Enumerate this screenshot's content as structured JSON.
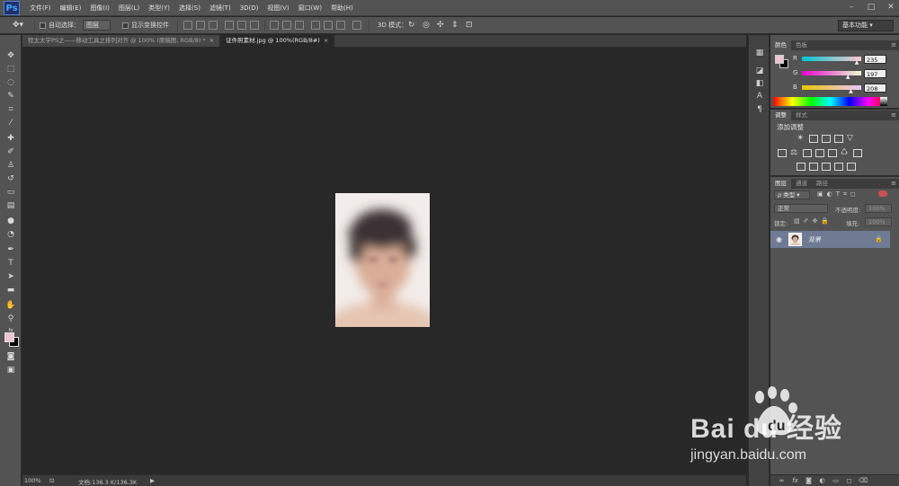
{
  "app": {
    "logo": "Ps",
    "menu": [
      "文件(F)",
      "编辑(E)",
      "图像(I)",
      "图层(L)",
      "类型(Y)",
      "选择(S)",
      "滤镜(T)",
      "3D(D)",
      "视图(V)",
      "窗口(W)",
      "帮助(H)"
    ],
    "window_controls": [
      "–",
      "□",
      "✕"
    ]
  },
  "options_bar": {
    "auto_select_label": "自动选择：",
    "auto_select_value": "图层",
    "show_transform_label": "显示变换控件",
    "mode_3d_label": "3D 模式：",
    "workspace": "基本功能"
  },
  "document_tabs": [
    {
      "label": "程太太学PS之——移动工具之排列对齐 @ 100% (原稿图, RGB/8) *",
      "active": false
    },
    {
      "label": "证件照素材.jpg @ 100%(RGB/8#)",
      "active": true
    }
  ],
  "status_bar": {
    "zoom": "100%",
    "doc_info": "文档:136.3 K/136.3K"
  },
  "color_panel": {
    "tabs": [
      "颜色",
      "色板"
    ],
    "foreground": "#ebc5d0",
    "channels": [
      {
        "name": "R",
        "value": "235",
        "fraction": 0.92
      },
      {
        "name": "G",
        "value": "197",
        "fraction": 0.77
      },
      {
        "name": "B",
        "value": "208",
        "fraction": 0.82
      }
    ]
  },
  "adjustments_panel": {
    "tabs": [
      "调整",
      "样式"
    ],
    "title": "添加调整"
  },
  "layers_panel": {
    "tabs": [
      "图层",
      "通道",
      "路径"
    ],
    "filter_type": "ρ 类型",
    "blend_mode": "正常",
    "opacity_label": "不透明度:",
    "opacity_value": "100%",
    "lock_label": "锁定:",
    "fill_label": "填充:",
    "fill_value": "100%",
    "layers": [
      {
        "name": "背景",
        "visible": true,
        "locked": true
      }
    ]
  },
  "watermark": {
    "text": "Bai du 经验",
    "url": "jingyan.baidu.com"
  }
}
